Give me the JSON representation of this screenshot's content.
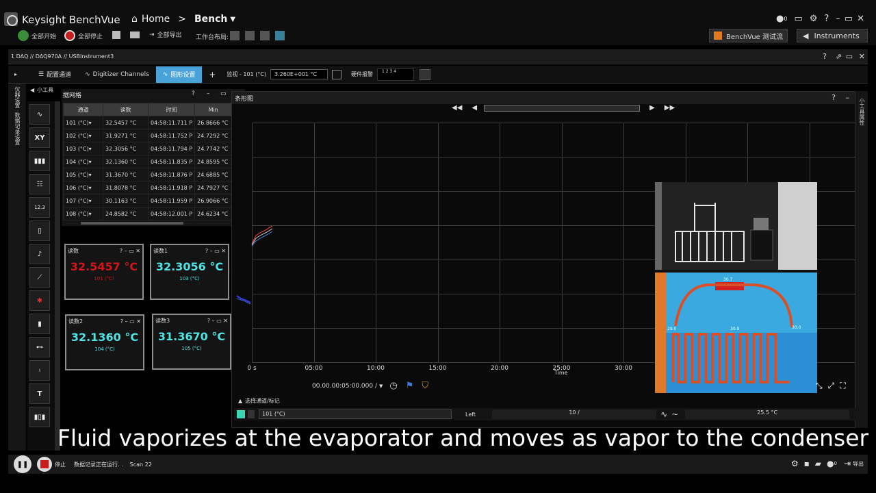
{
  "app": {
    "title": "Keysight BenchVue"
  },
  "nav": {
    "home": "Home",
    "sep": ">",
    "bench": "Bench"
  },
  "toolbar": {
    "start_all": "全部开始",
    "stop_all": "全部停止",
    "export_all": "全部导出",
    "workspace_layout": "工作台布局:"
  },
  "top_right": {
    "notif_count": "0",
    "test_flow": "BenchVue 测试流",
    "instruments": "Instruments"
  },
  "breadcrumb": "1 DAQ // DAQ970A // USBInstrument3",
  "tabs": [
    {
      "label": "配置通道"
    },
    {
      "label": "Digitizer Channels"
    },
    {
      "label": "图形设置"
    }
  ],
  "monitor": {
    "label": "监视 - 101 (°C)",
    "value": "3.260E+001 °C"
  },
  "hw_alarm": {
    "label": "硬件报警",
    "digits": "1  2  3  4"
  },
  "left_vertical": {
    "a": "仪器设置",
    "b": "数据记录设置"
  },
  "widgets_label": "小工具",
  "grid_widget": {
    "title": "据网格",
    "headers": [
      "通道",
      "读数",
      "时间",
      "Min"
    ],
    "rows": [
      [
        "101 (°C)▾",
        "32.5457 °C",
        "04:58:11.711 P",
        "26.8666 °C"
      ],
      [
        "102 (°C)▾",
        "31.9271 °C",
        "04:58:11.752 P",
        "24.7292 °C"
      ],
      [
        "103 (°C)▾",
        "32.3056 °C",
        "04:58:11.794 P",
        "24.7742 °C"
      ],
      [
        "104 (°C)▾",
        "32.1360 °C",
        "04:58:11.835 P",
        "24.8595 °C"
      ],
      [
        "105 (°C)▾",
        "31.3670 °C",
        "04:58:11.876 P",
        "24.6885 °C"
      ],
      [
        "106 (°C)▾",
        "31.8078 °C",
        "04:58:11.918 P",
        "24.7927 °C"
      ],
      [
        "107 (°C)▾",
        "30.1163 °C",
        "04:58:11.959 P",
        "26.9066 °C"
      ],
      [
        "108 (°C)▾",
        "24.8582 °C",
        "04:58:12.001 P",
        "24.6234 °C"
      ]
    ]
  },
  "meters": [
    {
      "title": "读数",
      "value": "32.5457 °C",
      "unit": "101 (°C)",
      "color": "#d0161b"
    },
    {
      "title": "读数1",
      "value": "32.3056 °C",
      "unit": "103 (°C)",
      "color": "#4fe3e3"
    },
    {
      "title": "读数2",
      "value": "32.1360 °C",
      "unit": "104 (°C)",
      "color": "#4fe3e3"
    },
    {
      "title": "读数3",
      "value": "31.3670 °C",
      "unit": "105 (°C)",
      "color": "#4fe3e3"
    }
  ],
  "chart_panel": {
    "title": "条形图",
    "x_ticks": [
      "0 s",
      "05:00",
      "10:00",
      "15:00",
      "20:00",
      "25:00",
      "30:00"
    ],
    "x_label": "Time",
    "time_range": "00.00.00:05:00.000 /",
    "select_label": "选择通道/标记",
    "channel": "101 (°C)",
    "cursor_side": "Left",
    "cursor_pos": "10  /",
    "cursor_value": "25.5 °C"
  },
  "right_vertical": "小工具属性",
  "caption": "Fluid vaporizes at the evaporator and moves as vapor to the condenser",
  "statusbar": {
    "stop": "停止",
    "running": "数据记录正在运行. .",
    "scan": "Scan 22",
    "export": "导出",
    "notif_count": "0"
  },
  "colors": {
    "accent": "#4aa3d8",
    "alarm_red": "#d0161b",
    "meter_cyan": "#4fe3e3"
  }
}
